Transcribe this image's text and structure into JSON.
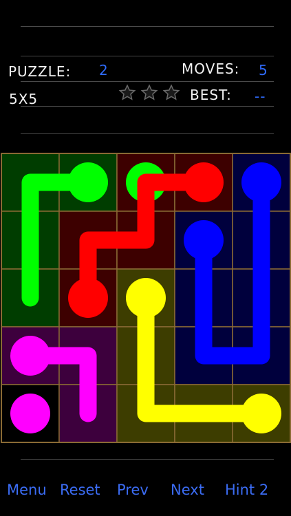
{
  "hud": {
    "puzzle_label": "PUZZLE:",
    "puzzle_value": "2",
    "moves_label": "MOVES:",
    "moves_value": "5",
    "size_label": "5X5",
    "best_label": "BEST:",
    "best_value": "--",
    "stars_earned": 0,
    "stars_total": 3
  },
  "board": {
    "rows": 5,
    "cols": 5,
    "grid_color": "#8a6a34",
    "cells": [
      [
        "#003d00",
        "#003d00",
        "#3d0000",
        "#3d0000",
        "#00003d"
      ],
      [
        "#003d00",
        "#3d0000",
        "#3d0000",
        "#00003d",
        "#00003d"
      ],
      [
        "#003d00",
        "#3d0000",
        "#3d3d00",
        "#00003d",
        "#00003d"
      ],
      [
        "#3d003d",
        "#3d003d",
        "#3d3d00",
        "#00003d",
        "#00003d"
      ],
      [
        "#000000",
        "#3d003d",
        "#3d3d00",
        "#3d3d00",
        "#3d3d00"
      ]
    ],
    "flows": [
      {
        "name": "green",
        "color": "#00ff00",
        "dots": [
          [
            1,
            0
          ],
          [
            2,
            0
          ]
        ],
        "path": [
          [
            1,
            0
          ],
          [
            0,
            0
          ],
          [
            0,
            2
          ]
        ]
      },
      {
        "name": "red",
        "color": "#ff0000",
        "dots": [
          [
            3,
            0
          ],
          [
            1,
            2
          ]
        ],
        "path": [
          [
            3,
            0
          ],
          [
            2,
            0
          ],
          [
            2,
            1
          ],
          [
            1,
            1
          ],
          [
            1,
            2
          ]
        ]
      },
      {
        "name": "blue",
        "color": "#0000ff",
        "dots": [
          [
            4,
            0
          ],
          [
            3,
            1
          ]
        ],
        "path": [
          [
            4,
            0
          ],
          [
            4,
            3
          ],
          [
            3,
            3
          ],
          [
            3,
            1
          ]
        ]
      },
      {
        "name": "yellow",
        "color": "#ffff00",
        "dots": [
          [
            2,
            2
          ],
          [
            4,
            4
          ]
        ],
        "path": [
          [
            2,
            2
          ],
          [
            2,
            4
          ],
          [
            4,
            4
          ]
        ]
      },
      {
        "name": "magenta",
        "color": "#ff00ff",
        "dots": [
          [
            0,
            3
          ],
          [
            0,
            4
          ]
        ],
        "path": [
          [
            0,
            3
          ],
          [
            1,
            3
          ],
          [
            1,
            4
          ]
        ]
      }
    ]
  },
  "bottom": {
    "menu": "Menu",
    "reset": "Reset",
    "prev": "Prev",
    "next": "Next",
    "hint": "Hint 2"
  }
}
